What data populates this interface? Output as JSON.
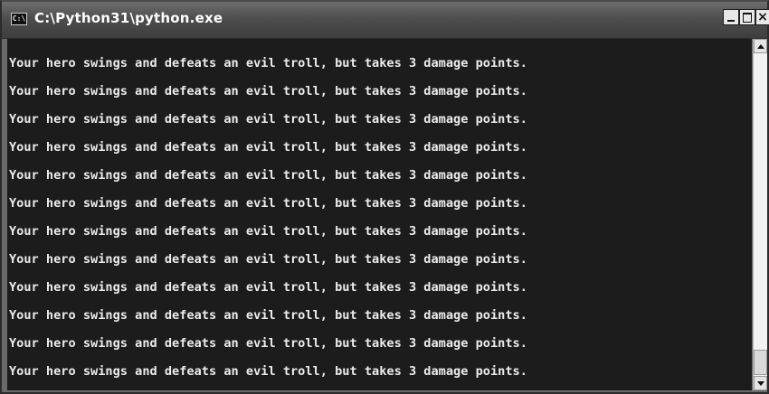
{
  "window": {
    "title": "C:\\Python31\\python.exe",
    "icon_text": "C:\\",
    "icon": "console-icon",
    "controls": {
      "minimize_icon": "minimize-icon",
      "maximize_icon": "maximize-icon",
      "close_label": "×"
    }
  },
  "console": {
    "background": "#1c1c1c",
    "text_color": "#ececec",
    "lines": [
      "Your hero swings and defeats an evil troll, but takes 3 damage points.",
      "Your hero swings and defeats an evil troll, but takes 3 damage points.",
      "Your hero swings and defeats an evil troll, but takes 3 damage points.",
      "Your hero swings and defeats an evil troll, but takes 3 damage points.",
      "Your hero swings and defeats an evil troll, but takes 3 damage points.",
      "Your hero swings and defeats an evil troll, but takes 3 damage points.",
      "Your hero swings and defeats an evil troll, but takes 3 damage points.",
      "Your hero swings and defeats an evil troll, but takes 3 damage points.",
      "Your hero swings and defeats an evil troll, but takes 3 damage points.",
      "Your hero swings and defeats an evil troll, but takes 3 damage points.",
      "Your hero swings and defeats an evil troll, but takes 3 damage points.",
      "Your hero swings and defeats an evil troll, but takes 3 damage points."
    ]
  },
  "scrollbar": {
    "up_icon": "arrow-up-icon",
    "down_icon": "arrow-down-icon"
  }
}
